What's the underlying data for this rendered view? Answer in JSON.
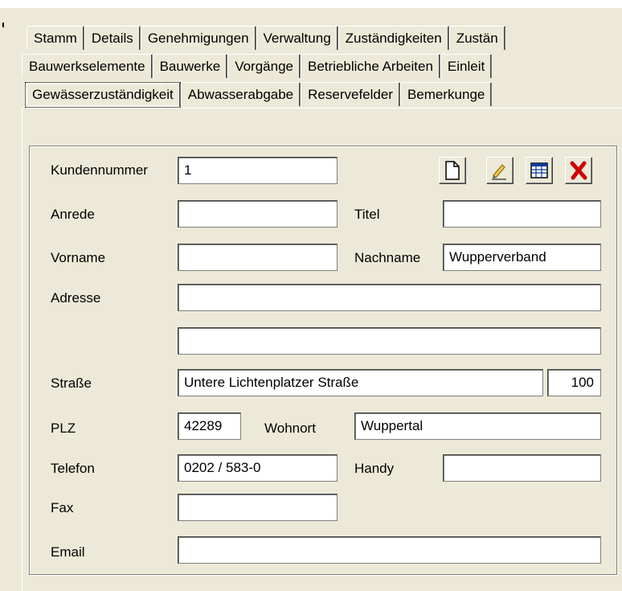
{
  "tabs": {
    "row1": [
      "Stamm",
      "Details",
      "Genehmigungen",
      "Verwaltung",
      "Zuständigkeiten",
      "Zustän"
    ],
    "row2": [
      "Bauwerkselemente",
      "Bauwerke",
      "Vorgänge",
      "Betriebliche Arbeiten",
      "Einleit"
    ],
    "row3": [
      "Gewässerzuständigkeit",
      "Abwasserabgabe",
      "Reservefelder",
      "Bemerkunge"
    ],
    "active": "Gewässerzuständigkeit"
  },
  "toolbar": {
    "icons": [
      "new-document-icon",
      "edit-icon",
      "table-icon",
      "delete-icon"
    ],
    "delete_color": "#cc0000"
  },
  "form": {
    "labels": {
      "kundennummer": "Kundennummer",
      "anrede": "Anrede",
      "titel": "Titel",
      "vorname": "Vorname",
      "nachname": "Nachname",
      "adresse": "Adresse",
      "strasse": "Straße",
      "plz": "PLZ",
      "wohnort": "Wohnort",
      "telefon": "Telefon",
      "handy": "Handy",
      "fax": "Fax",
      "email": "Email"
    },
    "values": {
      "kundennummer": "1",
      "anrede": "",
      "titel": "",
      "vorname": "",
      "nachname": "Wupperverband",
      "adresse1": "",
      "adresse2": "",
      "strasse": "Untere Lichtenplatzer Straße",
      "hausnummer": "100",
      "plz": "42289",
      "wohnort": "Wuppertal",
      "telefon": "0202 / 583-0",
      "handy": "",
      "fax": "",
      "email": ""
    }
  }
}
